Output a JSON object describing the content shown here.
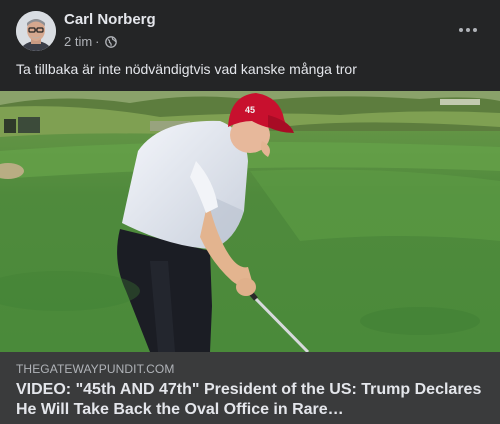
{
  "post": {
    "author": "Carl Norberg",
    "timestamp": "2 tim",
    "separator": "·",
    "privacy_icon": "globe-icon",
    "more_icon": "more-dots-icon",
    "caption": "Ta tillbaka är inte nödvändigtvis vad kanske många tror"
  },
  "media": {
    "description_icon": "video-thumbnail",
    "cap_text": "45"
  },
  "link_preview": {
    "domain": "THEGATEWAYPUNDIT.COM",
    "title": "VIDEO: \"45th AND 47th\" President of the US: Trump Declares He Will Take Back the Oval Office in Rare…"
  },
  "colors": {
    "background": "#242526",
    "link_box": "#3a3b3c",
    "text_primary": "#e4e6eb",
    "text_secondary": "#b0b3b8",
    "hat_red": "#c8102e"
  }
}
